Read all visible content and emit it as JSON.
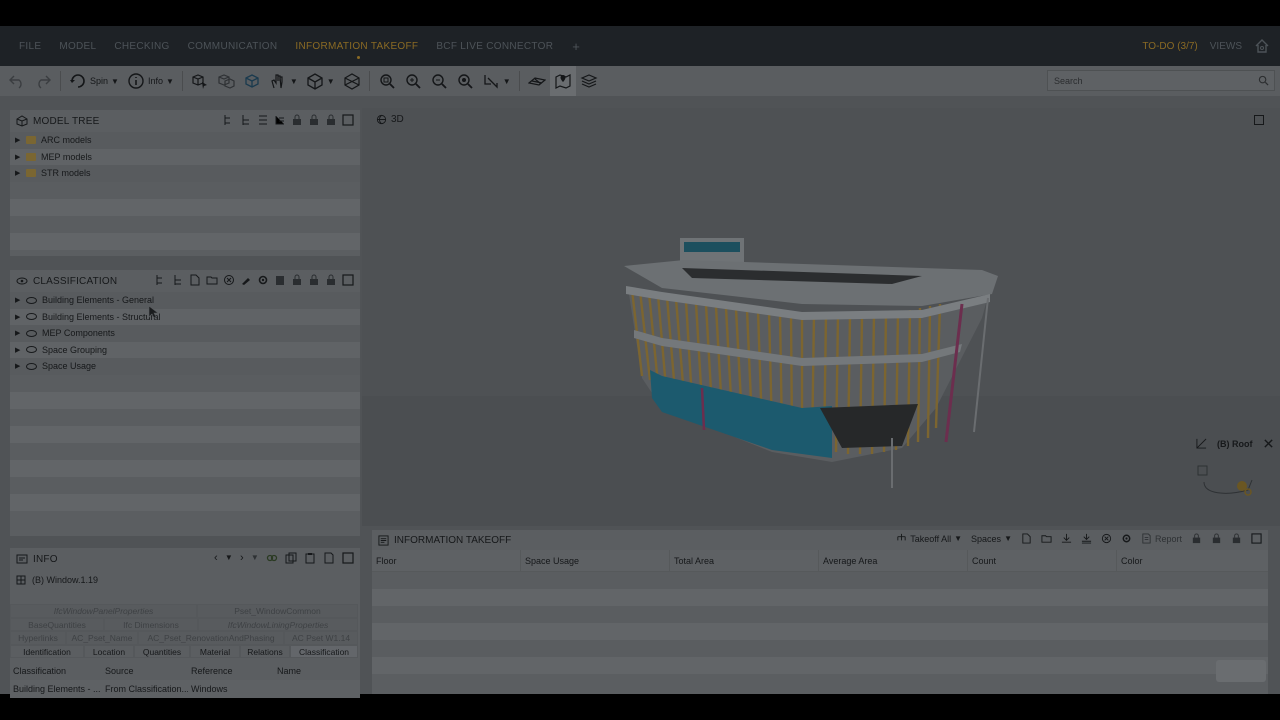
{
  "menu": {
    "items": [
      "FILE",
      "MODEL",
      "CHECKING",
      "COMMUNICATION",
      "INFORMATION TAKEOFF",
      "BCF LIVE CONNECTOR"
    ],
    "active": "INFORMATION TAKEOFF",
    "plus": "+",
    "todo": "TO-DO (3/7)",
    "views": "VIEWS"
  },
  "toolbar": {
    "spin_label": "Spin",
    "info_label": "Info",
    "search_placeholder": "Search"
  },
  "model_tree": {
    "title": "MODEL TREE",
    "items": [
      "ARC models",
      "MEP models",
      "STR models"
    ]
  },
  "classification": {
    "title": "CLASSIFICATION",
    "items": [
      "Building Elements - General",
      "Building Elements - Structural",
      "MEP Components",
      "Space Grouping",
      "Space Usage"
    ]
  },
  "viewport": {
    "label": "3D",
    "floor": "(B) Roof"
  },
  "takeoff": {
    "title": "INFORMATION TAKEOFF",
    "takeoff_all": "Takeoff All",
    "spaces": "Spaces",
    "report": "Report",
    "columns": [
      "Floor",
      "Space Usage",
      "Total Area",
      "Average Area",
      "Count",
      "Color"
    ]
  },
  "info": {
    "title": "INFO",
    "selected": "(B) Window.1.19",
    "tabs_row1": [
      "IfcWindowPanelProperties",
      "Pset_WindowCommon"
    ],
    "tabs_row2": [
      "BaseQuantities",
      "Ifc Dimensions",
      "IfcWindowLiningProperties"
    ],
    "tabs_row3": [
      "Hyperlinks",
      "AC_Pset_Name",
      "AC_Pset_RenovationAndPhasing",
      "AC Pset W1.14"
    ],
    "tabs_row4": [
      "Identification",
      "Location",
      "Quantities",
      "Material",
      "Relations",
      "Classification"
    ],
    "grid_head": [
      "Classification",
      "Source",
      "Reference",
      "Name"
    ],
    "grid_row": [
      "Building Elements - ...",
      "From Classification...",
      "Windows",
      ""
    ]
  },
  "colors": {
    "accent": "#8a6a24",
    "glass": "#1c5a6e",
    "mullion": "#7c6530",
    "pipe": "#6c2e4e"
  }
}
